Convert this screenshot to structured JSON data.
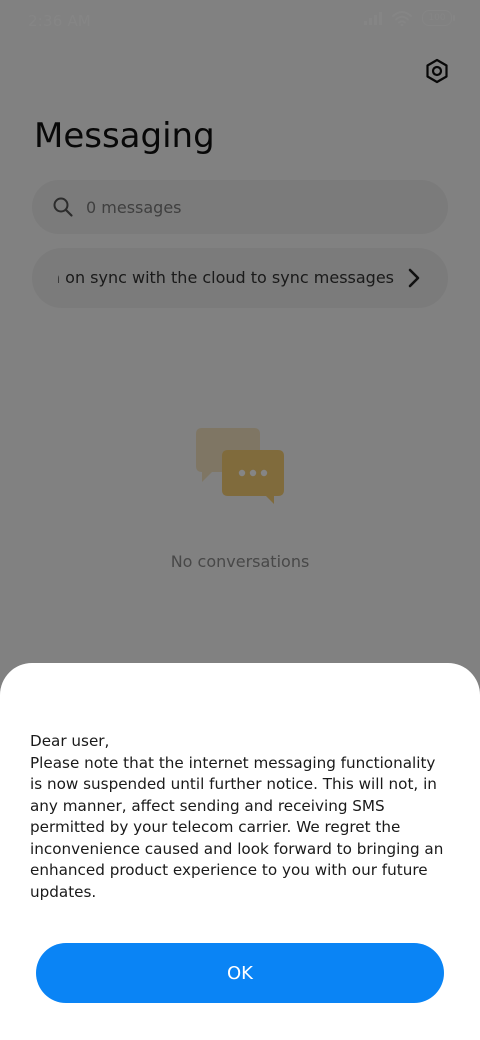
{
  "status_bar": {
    "time": "2:36 AM",
    "battery": "100",
    "icons": [
      "signal-icon",
      "wifi-icon",
      "battery-icon"
    ]
  },
  "header": {
    "title": "Messaging",
    "settings_icon": "settings-icon"
  },
  "search": {
    "placeholder": "0 messages",
    "icon": "search-icon"
  },
  "sync_banner": {
    "text": "Turn on sync with the cloud to sync messages",
    "icon": "chevron-right-icon"
  },
  "empty_state": {
    "icon": "conversations-icon",
    "text": "No conversations"
  },
  "dialog": {
    "message": "Dear user,\nPlease note that the internet messaging functionality is now suspended until further notice. This will not, in any manner, affect sending and receiving SMS permitted by your telecom carrier. We regret the inconvenience caused and look forward to bringing an enhanced product experience to you with our future updates.",
    "ok_label": "OK"
  },
  "colors": {
    "accent": "#0a84f5",
    "illustration_back": "#f3e3c0",
    "illustration_front": "#f5cd73"
  }
}
